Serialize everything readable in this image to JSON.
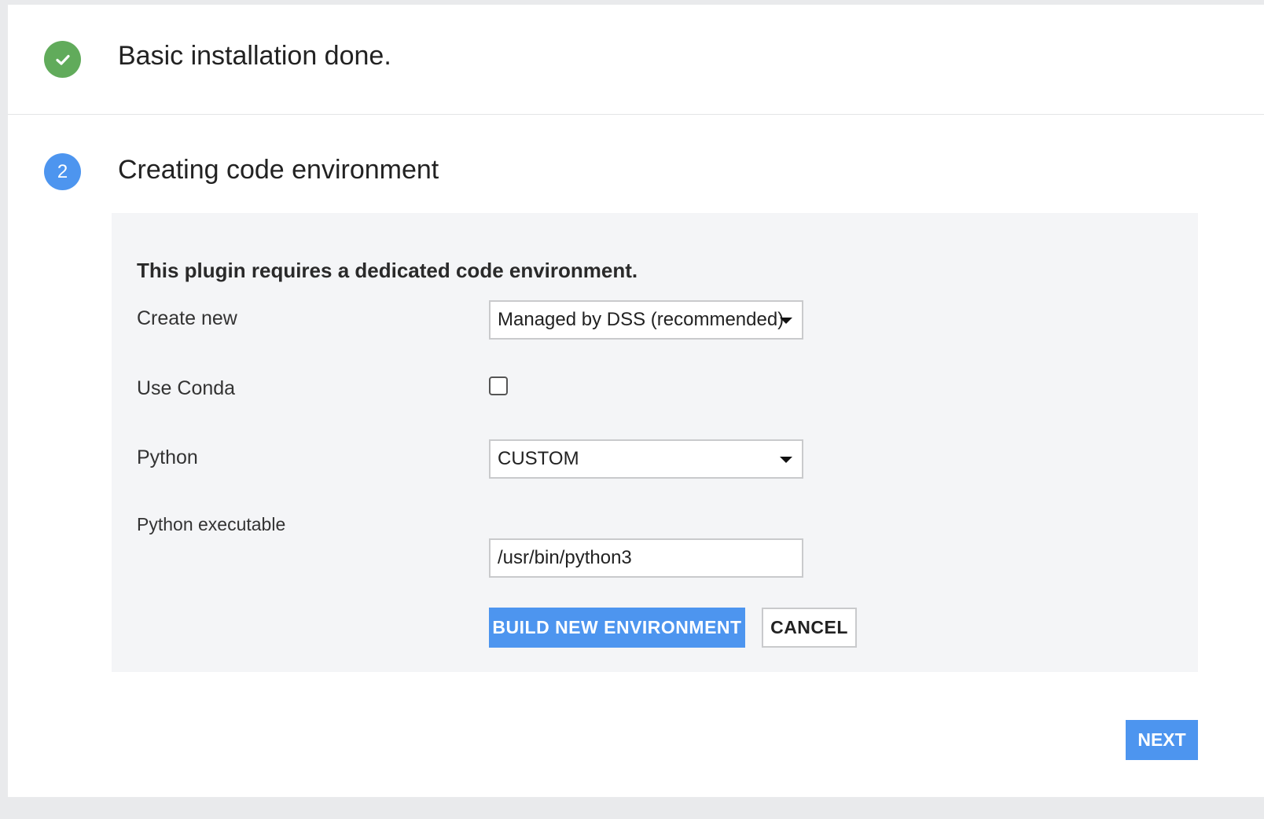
{
  "steps": [
    {
      "status": "done",
      "title": "Basic installation done.",
      "icon": "check-icon"
    },
    {
      "status": "active",
      "number": "2",
      "title": "Creating code environment"
    }
  ],
  "form": {
    "intro": "This plugin requires a dedicated code environment.",
    "create_new": {
      "label": "Create new",
      "value": "Managed by DSS (recommended)"
    },
    "use_conda": {
      "label": "Use Conda",
      "checked": false
    },
    "python": {
      "label": "Python",
      "value": "CUSTOM"
    },
    "python_executable": {
      "label": "Python executable",
      "value": "/usr/bin/python3"
    },
    "build_button": "BUILD NEW ENVIRONMENT",
    "cancel_button": "CANCEL"
  },
  "footer": {
    "next_button": "NEXT"
  },
  "colors": {
    "success": "#61ab5b",
    "primary": "#4d95ef",
    "panel_bg": "#f4f5f7"
  }
}
